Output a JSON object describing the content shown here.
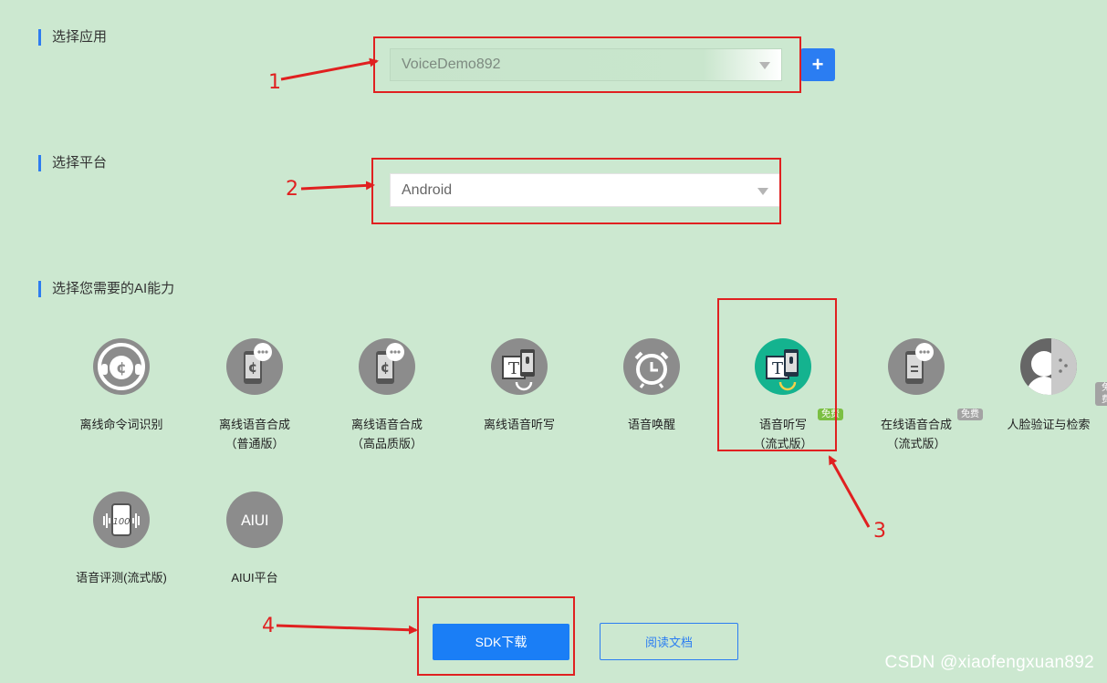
{
  "sections": {
    "app_title": "选择应用",
    "platform_title": "选择平台",
    "ability_title": "选择您需要的AI能力"
  },
  "app_select": {
    "value": "VoiceDemo892",
    "add_label": "+"
  },
  "platform_select": {
    "value": "Android"
  },
  "capabilities": [
    {
      "label": "离线命令词识别",
      "icon": "headset-icon"
    },
    {
      "label": "离线语音合成\n（普通版）",
      "icon": "phone-chat-icon"
    },
    {
      "label": "离线语音合成\n（高品质版）",
      "icon": "phone-chat-icon"
    },
    {
      "label": "离线语音听写",
      "icon": "text-phone-icon"
    },
    {
      "label": "语音唤醒",
      "icon": "alarm-clock-icon"
    },
    {
      "label": "语音听写\n（流式版）",
      "icon": "text-phone-icon",
      "badge": "免费",
      "selected": true
    },
    {
      "label": "在线语音合成\n（流式版）",
      "icon": "phone-chat-icon",
      "badge": "免费"
    },
    {
      "label": "人脸验证与检索",
      "icon": "face-icon",
      "badge": "免费"
    },
    {
      "label": "语音评测(流式版)",
      "icon": "score-phone-icon"
    },
    {
      "label": "AIUI平台",
      "icon": "aiui-icon",
      "icon_text": "AIUI"
    }
  ],
  "buttons": {
    "download": "SDK下载",
    "docs": "阅读文档"
  },
  "annotations": [
    "1",
    "2",
    "3",
    "4"
  ],
  "watermark": "CSDN @xiaofengxuan892",
  "colors": {
    "accent": "#2b7df2",
    "annotation": "#e02020",
    "background": "#cce8d0",
    "selected_icon": "#14b38f"
  }
}
